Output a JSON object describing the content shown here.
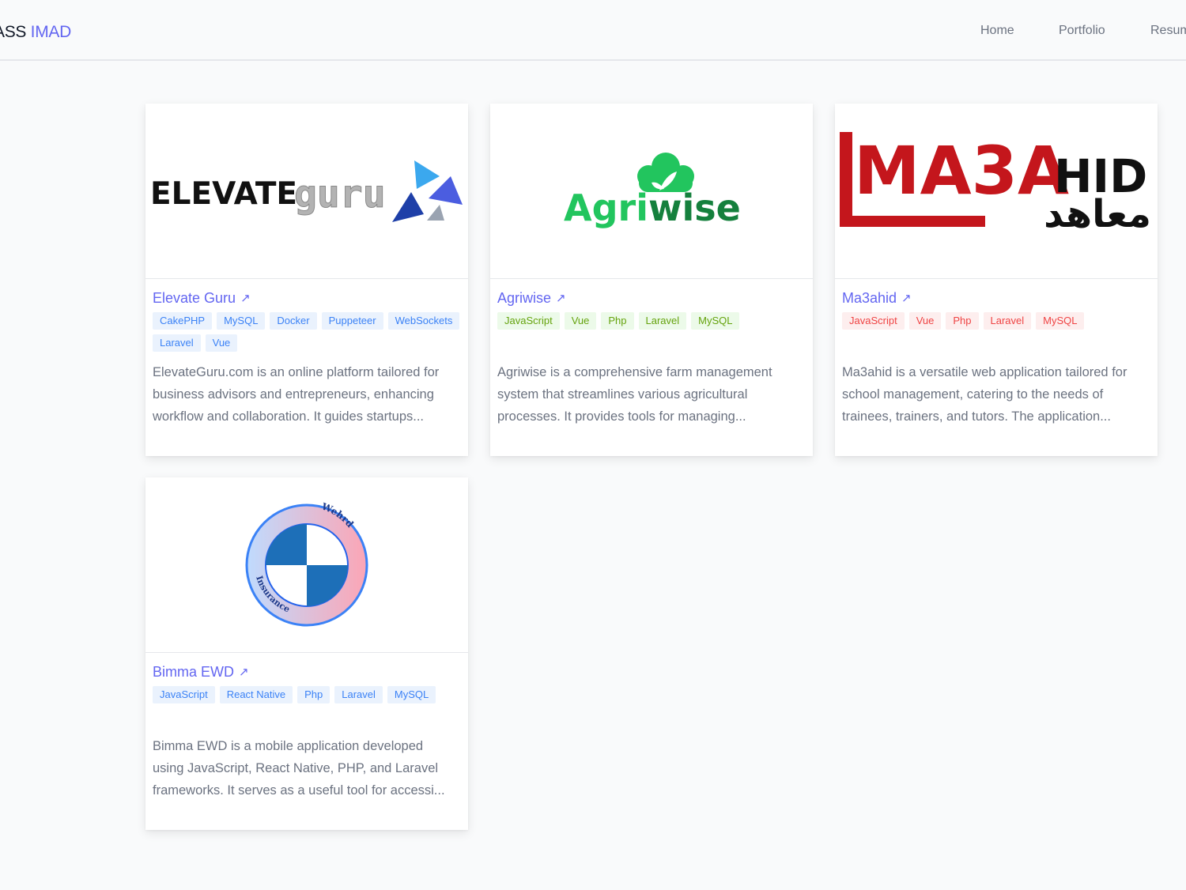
{
  "nav": {
    "brand_prefix": "ASS",
    "brand_accent": "IMAD",
    "links": [
      "Home",
      "Portfolio",
      "Resume"
    ]
  },
  "projects": [
    {
      "title": "Elevate Guru",
      "link_icon": "external-arrow-icon",
      "logo_text_dark": "ELEVATE",
      "logo_text_light": "guru",
      "tag_color": "#3b82f6",
      "tags": [
        "CakePHP",
        "MySQL",
        "Docker",
        "Puppeteer",
        "WebSockets",
        "Laravel",
        "Vue"
      ],
      "description_lines": [
        "ElevateGuru.com is an online platform tailored for",
        "business advisors and entrepreneurs, enhancing",
        "workflow and collaboration. It guides startups..."
      ]
    },
    {
      "title": "Agriwise",
      "link_icon": "external-arrow-icon",
      "logo_text_a": "Agri",
      "logo_text_b": "wise",
      "tag_color": "#65a30d",
      "tags": [
        "JavaScript",
        "Vue",
        "Php",
        "Laravel",
        "MySQL"
      ],
      "description_lines": [
        "Agriwise is a comprehensive farm management",
        "system that streamlines various agricultural",
        "processes. It provides tools for managing..."
      ]
    },
    {
      "title": "Ma3ahid",
      "link_icon": "external-arrow-icon",
      "logo_text_red": "MA3A",
      "logo_text_black": "HID",
      "logo_text_arabic": "معاهد",
      "tag_color": "#ef4444",
      "tags": [
        "JavaScript",
        "Vue",
        "Php",
        "Laravel",
        "MySQL"
      ],
      "description_lines": [
        "Ma3ahid is a versatile web application tailored for",
        "school management, catering to the needs of",
        "trainees, trainers, and tutors. The application..."
      ]
    },
    {
      "title": "Bimma EWD",
      "link_icon": "external-arrow-icon",
      "logo_text_top": "Wehrd",
      "logo_text_bottom": "Insurance",
      "tag_color": "#3b82f6",
      "tags": [
        "JavaScript",
        "React Native",
        "Php",
        "Laravel",
        "MySQL"
      ],
      "description_lines": [
        "Bimma EWD is a mobile application developed",
        "using JavaScript, React Native, PHP, and Laravel",
        "frameworks. It serves as a useful tool for accessi..."
      ]
    }
  ]
}
